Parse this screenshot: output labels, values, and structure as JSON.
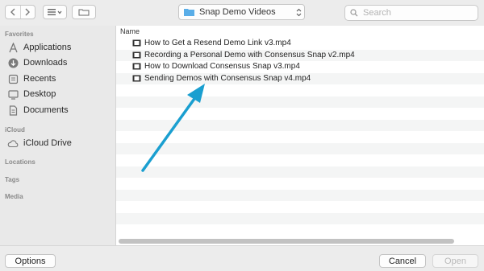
{
  "toolbar": {
    "back_icon": "chevron-left-icon",
    "forward_icon": "chevron-right-icon",
    "view_icon": "list-view-icon",
    "new_folder_icon": "new-folder-icon",
    "location": "Snap Demo Videos",
    "search_placeholder": "Search"
  },
  "sidebar": {
    "favorites_header": "Favorites",
    "favorites": [
      {
        "label": "Applications",
        "icon": "applications-icon"
      },
      {
        "label": "Downloads",
        "icon": "downloads-icon"
      },
      {
        "label": "Recents",
        "icon": "recents-icon"
      },
      {
        "label": "Desktop",
        "icon": "desktop-icon"
      },
      {
        "label": "Documents",
        "icon": "documents-icon"
      }
    ],
    "icloud_header": "iCloud",
    "icloud": [
      {
        "label": "iCloud Drive",
        "icon": "cloud-icon"
      }
    ],
    "locations_header": "Locations",
    "tags_header": "Tags",
    "media_header": "Media"
  },
  "content": {
    "column_name": "Name",
    "files": [
      {
        "name": "How to Get a Resend Demo Link v3.mp4"
      },
      {
        "name": "Recording a Personal Demo with Consensus Snap v2.mp4"
      },
      {
        "name": "How to Download Consensus Snap v3.mp4"
      },
      {
        "name": "Sending Demos with Consensus Snap v4.mp4"
      }
    ],
    "annotation": {
      "type": "arrow",
      "color": "#1a9fd0"
    }
  },
  "footer": {
    "options_label": "Options",
    "cancel_label": "Cancel",
    "open_label": "Open"
  },
  "colors": {
    "folder": "#5aaee8",
    "accent_arrow": "#1a9fd0"
  }
}
